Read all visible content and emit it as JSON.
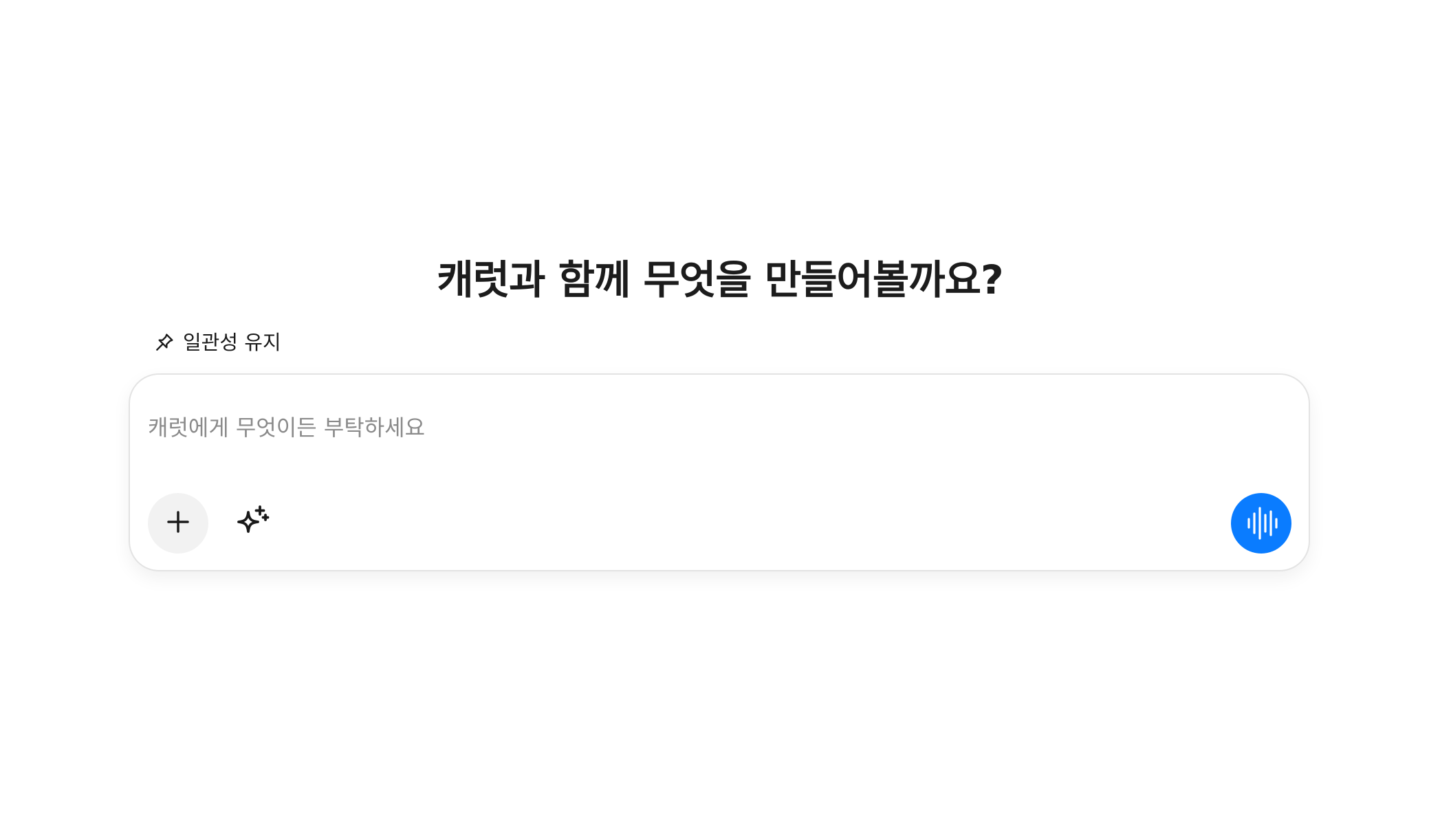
{
  "headline": "캐럿과 함께 무엇을 만들어볼까요?",
  "pin_toggle": {
    "label": "일관성 유지",
    "icon": "pin-icon"
  },
  "composer": {
    "placeholder": "캐럿에게 무엇이든 부탁하세요",
    "value": "",
    "attach_icon": "plus-icon",
    "enhance_icon": "sparkles-icon",
    "voice_icon": "waveform-icon"
  },
  "colors": {
    "accent": "#0a7cff",
    "attach_bg": "#f2f2f2",
    "border": "#e3e3e3",
    "placeholder": "#8a8a8a",
    "text": "#1a1a1a"
  }
}
